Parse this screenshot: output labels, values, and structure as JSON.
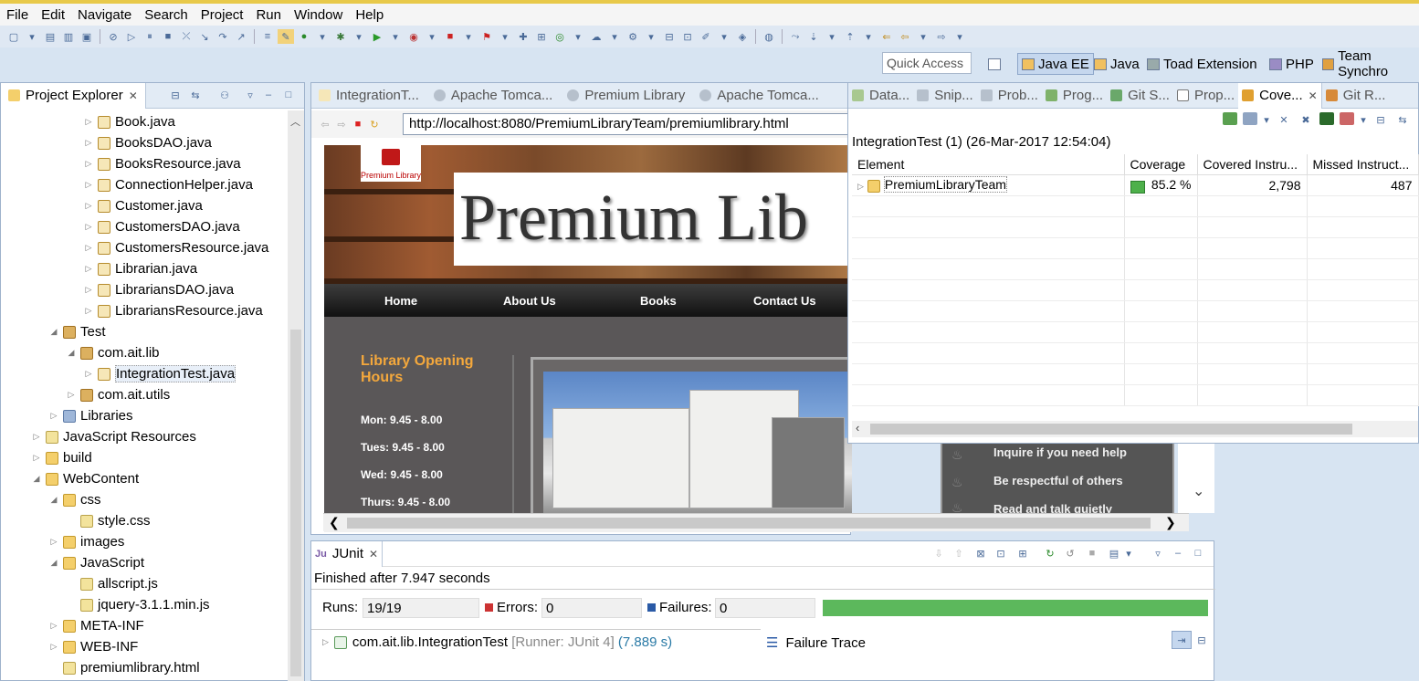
{
  "menu": [
    "File",
    "Edit",
    "Navigate",
    "Search",
    "Project",
    "Run",
    "Window",
    "Help"
  ],
  "quick_access": "Quick Access",
  "perspectives": [
    "Java EE",
    "Java",
    "Toad Extension",
    "PHP",
    "Team Synchro"
  ],
  "project_explorer": {
    "tab_title": "Project Explorer",
    "items": [
      {
        "label": "Book.java",
        "icon": "java-file-icon"
      },
      {
        "label": "BooksDAO.java",
        "icon": "java-file-icon"
      },
      {
        "label": "BooksResource.java",
        "icon": "java-file-icon"
      },
      {
        "label": "ConnectionHelper.java",
        "icon": "java-file-icon"
      },
      {
        "label": "Customer.java",
        "icon": "java-file-icon"
      },
      {
        "label": "CustomersDAO.java",
        "icon": "java-file-icon"
      },
      {
        "label": "CustomersResource.java",
        "icon": "java-file-icon"
      },
      {
        "label": "Librarian.java",
        "icon": "java-file-icon"
      },
      {
        "label": "LibrariansDAO.java",
        "icon": "java-file-icon"
      },
      {
        "label": "LibrariansResource.java",
        "icon": "java-file-icon"
      },
      {
        "label": "Test",
        "icon": "source-folder-icon"
      },
      {
        "label": "com.ait.lib",
        "icon": "package-icon"
      },
      {
        "label": "IntegrationTest.java",
        "icon": "java-file-icon"
      },
      {
        "label": "com.ait.utils",
        "icon": "package-icon"
      },
      {
        "label": "Libraries",
        "icon": "library-icon"
      },
      {
        "label": "JavaScript Resources",
        "icon": "js-resources-icon"
      },
      {
        "label": "build",
        "icon": "folder-icon"
      },
      {
        "label": "WebContent",
        "icon": "folder-icon"
      },
      {
        "label": "css",
        "icon": "folder-icon"
      },
      {
        "label": "style.css",
        "icon": "css-file-icon"
      },
      {
        "label": "images",
        "icon": "folder-icon"
      },
      {
        "label": "JavaScript",
        "icon": "folder-icon"
      },
      {
        "label": "allscript.js",
        "icon": "js-file-icon"
      },
      {
        "label": "jquery-3.1.1.min.js",
        "icon": "js-file-icon"
      },
      {
        "label": "META-INF",
        "icon": "folder-icon"
      },
      {
        "label": "WEB-INF",
        "icon": "folder-icon"
      },
      {
        "label": "premiumlibrary.html",
        "icon": "html-file-icon"
      }
    ]
  },
  "editor_tabs": [
    "IntegrationT...",
    "Apache Tomca...",
    "Premium Library",
    "Apache Tomca..."
  ],
  "browser": {
    "url": "http://localhost:8080/PremiumLibraryTeam/premiumlibrary.html",
    "site": {
      "logo_text": "Premium Library",
      "banner_title": "Premium Lib",
      "nav": [
        "Home",
        "About Us",
        "Books",
        "Contact Us"
      ],
      "hours_title": "Library Opening Hours",
      "hours": [
        "Mon: 9.45 - 8.00",
        "Tues: 9.45 - 8.00",
        "Wed: 9.45 - 8.00",
        "Thurs: 9.45 - 8.00"
      ],
      "rules": [
        "Inquire if you need help",
        "Be respectful of others",
        "Read and talk quietly"
      ]
    }
  },
  "views_tabs": [
    "Data...",
    "Snip...",
    "Prob...",
    "Prog...",
    "Git S...",
    "Prop...",
    "Cove...",
    "Git R..."
  ],
  "coverage": {
    "session": "IntegrationTest (1) (26-Mar-2017 12:54:04)",
    "columns": [
      "Element",
      "Coverage",
      "Covered Instru...",
      "Missed Instruct..."
    ],
    "rows": [
      {
        "element": "PremiumLibraryTeam",
        "coverage": "85.2 %",
        "covered": "2,798",
        "missed": "487"
      }
    ],
    "bar_color": "#4db04a"
  },
  "junit": {
    "tab_title": "JUnit",
    "finished": "Finished after 7.947 seconds",
    "runs_label": "Runs:",
    "runs": "19/19",
    "errors_label": "Errors:",
    "errors": "0",
    "failures_label": "Failures:",
    "failures": "0",
    "progress_color": "#5cb85c",
    "test_class": "com.ait.lib.IntegrationTest",
    "runner": "[Runner: JUnit 4]",
    "time": "(7.889 s)",
    "failure_trace": "Failure Trace"
  }
}
